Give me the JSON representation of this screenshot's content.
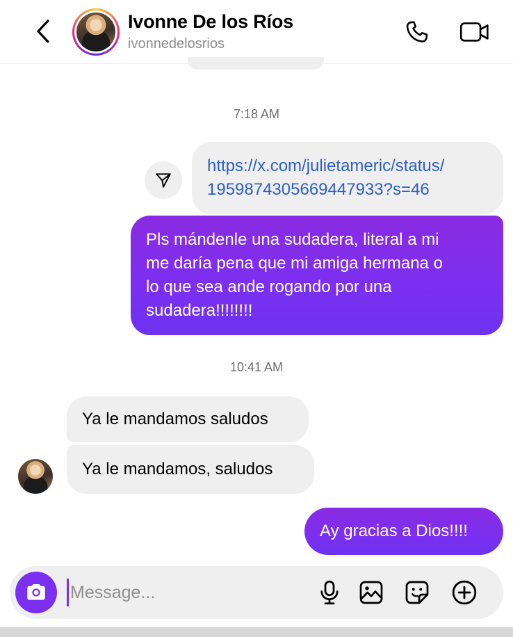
{
  "header": {
    "contact_name": "Ivonne De los Ríos",
    "contact_handle": "ivonnedelosrios",
    "back_icon": "chevron-left-icon",
    "call_icon": "phone-icon",
    "video_icon": "video-camera-icon"
  },
  "thread": {
    "timestamps": [
      "7:18 AM",
      "10:41 AM"
    ],
    "messages": [
      {
        "sender": "me",
        "type": "link",
        "text": "https://x.com/julietameric/status/1959874305669447933?s=46",
        "lines": [
          "https://x.com/julietameric/status/",
          "1959874305669447933?s=46"
        ]
      },
      {
        "sender": "me",
        "type": "text",
        "lines": [
          "Pls mándenle una sudadera, literal a mi",
          "me daría pena que mi amiga hermana o",
          "lo que sea ande rogando por una",
          "sudadera!!!!!!!!"
        ]
      },
      {
        "sender": "them",
        "type": "text",
        "text": "Ya le mandamos saludos"
      },
      {
        "sender": "them",
        "type": "text",
        "text": "Ya le mandamos, saludos"
      },
      {
        "sender": "me",
        "type": "text",
        "text": "Ay gracias a Dios!!!!"
      }
    ]
  },
  "composer": {
    "placeholder": "Message...",
    "value": "",
    "camera_icon": "camera-icon",
    "mic_icon": "microphone-icon",
    "gallery_icon": "image-icon",
    "sticker_icon": "sticker-icon",
    "add_icon": "plus-circle-icon"
  },
  "colors": {
    "accent": "#7b2ff0",
    "incoming_bubble": "#efefef",
    "link": "#2d5fc4",
    "secondary_text": "#8e8e8e"
  }
}
